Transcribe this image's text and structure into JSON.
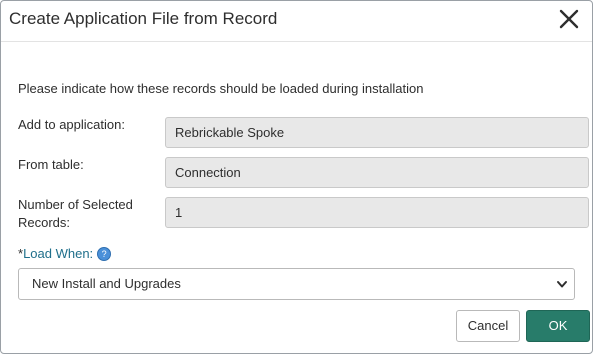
{
  "dialog": {
    "title": "Create Application File from Record",
    "close_icon": "close-icon",
    "intro": "Please indicate how these records should be loaded during installation",
    "fields": [
      {
        "label": "Add to application:",
        "value": "Rebrickable Spoke"
      },
      {
        "label": "From table:",
        "value": "Connection"
      },
      {
        "label": "Number of Selected Records:",
        "value": "1"
      }
    ],
    "load_when": {
      "required_marker": "*",
      "label": "Load When:",
      "help_icon": "help-icon",
      "selected": "New Install and Upgrades"
    },
    "buttons": {
      "cancel": "Cancel",
      "ok": "OK"
    }
  },
  "colors": {
    "primary": "#287c6a",
    "link": "#1f6f8b",
    "readonly_bg": "#e8e8e8"
  }
}
